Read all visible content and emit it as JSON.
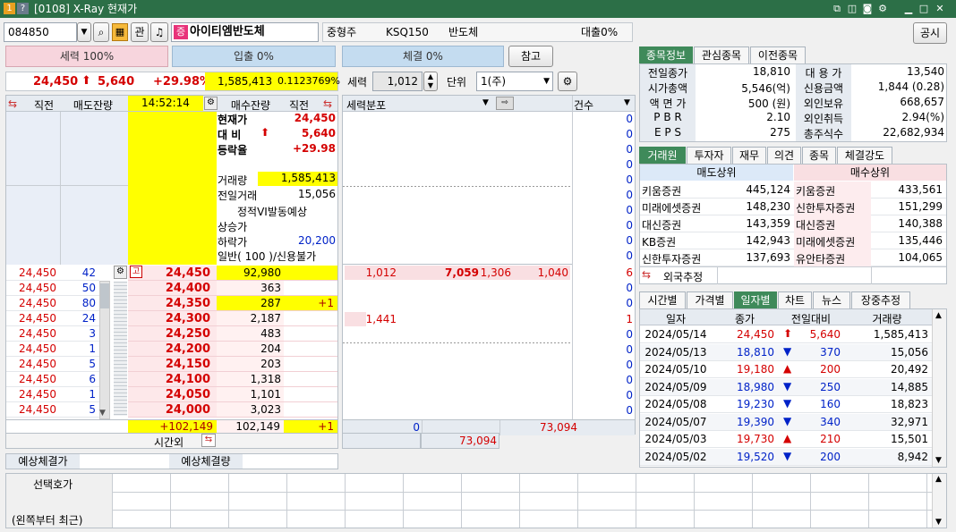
{
  "window": {
    "title": "[0108] X-Ray 현재가"
  },
  "top": {
    "code": "084850",
    "fav_label": "관",
    "stock_badge": "증",
    "stock_name": "아이티엠반도체",
    "size": "중형주",
    "market": "KSQ150",
    "sector": "반도체",
    "loan": "대출0%",
    "notice_button": "공시"
  },
  "bars": {
    "power": "세력 100%",
    "inflow": "입출 0%",
    "exec": "체결 0%",
    "ref_button": "참고"
  },
  "price": {
    "current": "24,450",
    "arrow": "⬆",
    "change": "5,640",
    "rate": "+29.98%",
    "volume": "1,585,413",
    "ratio": "0.1123769%"
  },
  "controls": {
    "power_label": "세력",
    "power_value": "1,012",
    "unit_label": "단위",
    "unit_value": "1(주)"
  },
  "orderbook": {
    "head": {
      "prev": "직전",
      "sell": "매도잔량",
      "time": "14:52:14",
      "buy": "매수잔량",
      "prev2": "직전"
    },
    "info": {
      "cur_label": "현재가",
      "cur_val": "24,450",
      "diff_label": "대 비",
      "diff_val": "5,640",
      "rate_label": "등락율",
      "rate_val": "+29.98",
      "vol_label": "거래량",
      "vol_val": "1,585,413",
      "prevvol_label": "전일거래",
      "prevvol_val": "15,056",
      "vi_label": "정적VI발동예상",
      "upper_label": "상승가",
      "lower_label": "하락가",
      "lower_val": "20,200",
      "general_label": "일반( 100 )/신용불가"
    },
    "ask_marker": "고",
    "rows": [
      {
        "lp": "24,450",
        "lq": "42",
        "price": "24,450",
        "bq": "92,980",
        "bp": ""
      },
      {
        "lp": "24,450",
        "lq": "50",
        "price": "24,400",
        "bq": "363",
        "bp": ""
      },
      {
        "lp": "24,450",
        "lq": "80",
        "price": "24,350",
        "bq": "287",
        "bp": "+1"
      },
      {
        "lp": "24,450",
        "lq": "24",
        "price": "24,300",
        "bq": "2,187",
        "bp": ""
      },
      {
        "lp": "24,450",
        "lq": "3",
        "price": "24,250",
        "bq": "483",
        "bp": ""
      },
      {
        "lp": "24,450",
        "lq": "1",
        "price": "24,200",
        "bq": "204",
        "bp": ""
      },
      {
        "lp": "24,450",
        "lq": "5",
        "price": "24,150",
        "bq": "203",
        "bp": ""
      },
      {
        "lp": "24,450",
        "lq": "6",
        "price": "24,100",
        "bq": "1,318",
        "bp": ""
      },
      {
        "lp": "24,450",
        "lq": "1",
        "price": "24,050",
        "bq": "1,101",
        "bp": ""
      },
      {
        "lp": "24,450",
        "lq": "5",
        "price": "24,000",
        "bq": "3,023",
        "bp": ""
      }
    ],
    "totals": {
      "diff": "+102,149",
      "total": "102,149",
      "plus": "+1"
    },
    "after_hours": "시간외"
  },
  "power": {
    "label": "세력분포",
    "count_label": "건수",
    "zeros": [
      "0",
      "0",
      "0",
      "0",
      "0",
      "0",
      "0",
      "0",
      "0",
      "0"
    ],
    "row1": {
      "a": "1,012",
      "b": "7,059",
      "c": "1,306",
      "d": "1,040",
      "cnt": "6"
    },
    "row2": {
      "a": "1,441",
      "cnt": "1"
    },
    "rows_cnt": [
      "0",
      "0",
      "0",
      "0",
      "0",
      "0",
      "0",
      "0"
    ],
    "sum1": "0",
    "sum2": "73,094",
    "sum3": "73,094"
  },
  "expect": {
    "exec": "예상체결가",
    "vol": "예상체결량"
  },
  "info_tabs": [
    "종목정보",
    "관심종목",
    "이전종목"
  ],
  "info": {
    "left": [
      {
        "k": "전일종가",
        "v": "18,810"
      },
      {
        "k": "시가총액",
        "v": "5,546(억)"
      },
      {
        "k": "액 면 가",
        "v": "500 (원)"
      },
      {
        "k": "P B R",
        "v": "2.10"
      },
      {
        "k": "E P S",
        "v": "275"
      }
    ],
    "right": [
      {
        "k": "대 용 가",
        "v": "13,540"
      },
      {
        "k": "신용금액",
        "v": "1,844  (0.28)"
      },
      {
        "k": "외인보유",
        "v": "668,657"
      },
      {
        "k": "외인취득",
        "v": "2.94(%)"
      },
      {
        "k": "총주식수",
        "v": "22,682,934"
      }
    ]
  },
  "broker_tabs": [
    "거래원",
    "투자자",
    "재무",
    "의견",
    "종목",
    "체결강도"
  ],
  "broker": {
    "sell_head": "매도상위",
    "buy_head": "매수상위",
    "rows": [
      {
        "s": "키움증권",
        "sv": "445,124",
        "b": "키움증권",
        "bv": "433,561"
      },
      {
        "s": "미래에셋증권",
        "sv": "148,230",
        "b": "신한투자증권",
        "bv": "151,299"
      },
      {
        "s": "대신증권",
        "sv": "143,359",
        "b": "대신증권",
        "bv": "140,388"
      },
      {
        "s": "KB증권",
        "sv": "142,943",
        "b": "미래에셋증권",
        "bv": "135,446"
      },
      {
        "s": "신한투자증권",
        "sv": "137,693",
        "b": "유안타증권",
        "bv": "104,065"
      }
    ],
    "foreign": "외국추정"
  },
  "hist_tabs": [
    "시간별",
    "가격별",
    "일자별",
    "차트",
    "뉴스",
    "장중추정"
  ],
  "hist": {
    "head": {
      "date": "일자",
      "close": "종가",
      "diff": "전일대비",
      "vol": "거래량"
    },
    "rows": [
      {
        "d": "2024/05/14",
        "c": "24,450",
        "a": "⬆",
        "v": "5,640",
        "q": "1,585,413",
        "col": "red"
      },
      {
        "d": "2024/05/13",
        "c": "18,810",
        "a": "▼",
        "v": "370",
        "q": "15,056",
        "col": "blue"
      },
      {
        "d": "2024/05/10",
        "c": "19,180",
        "a": "▲",
        "v": "200",
        "q": "20,492",
        "col": "red"
      },
      {
        "d": "2024/05/09",
        "c": "18,980",
        "a": "▼",
        "v": "250",
        "q": "14,885",
        "col": "blue"
      },
      {
        "d": "2024/05/08",
        "c": "19,230",
        "a": "▼",
        "v": "160",
        "q": "18,823",
        "col": "blue"
      },
      {
        "d": "2024/05/07",
        "c": "19,390",
        "a": "▼",
        "v": "340",
        "q": "32,971",
        "col": "blue"
      },
      {
        "d": "2024/05/03",
        "c": "19,730",
        "a": "▲",
        "v": "210",
        "q": "15,501",
        "col": "red"
      },
      {
        "d": "2024/05/02",
        "c": "19,520",
        "a": "▼",
        "v": "200",
        "q": "8,942",
        "col": "blue"
      }
    ]
  },
  "bottom": {
    "label1": "선택호가",
    "label2": "(왼쪽부터 최근)"
  },
  "colors": {
    "title": "#2c6f47",
    "up": "#d40000",
    "down": "#0022c8",
    "yellow": "#ffff00",
    "tab": "#3f8a5a"
  }
}
